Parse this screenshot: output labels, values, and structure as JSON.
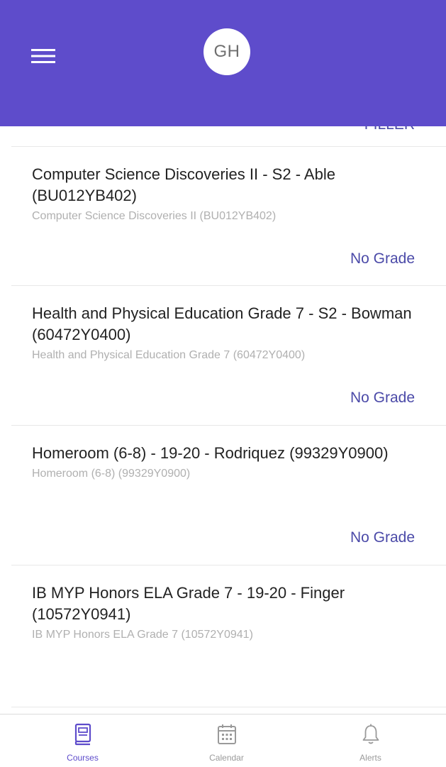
{
  "header": {
    "avatar_initials": "GH",
    "background_color": "#5e4ccb"
  },
  "list": {
    "partial_top_text": "FILLER",
    "courses": [
      {
        "title": "Computer Science Discoveries II - S2 - Able (BU012YB402)",
        "subtitle": "Computer Science Discoveries II (BU012YB402)",
        "grade": "No Grade"
      },
      {
        "title": "Health and Physical Education  Grade 7 - S2 - Bowman (60472Y0400)",
        "subtitle": "Health and Physical Education  Grade 7 (60472Y0400)",
        "grade": "No Grade"
      },
      {
        "title": "Homeroom (6-8) - 19-20 - Rodriquez (99329Y0900)",
        "subtitle": "Homeroom (6-8) (99329Y0900)",
        "grade": "No Grade"
      },
      {
        "title": "IB MYP Honors ELA Grade 7 - 19-20 - Finger (10572Y0941)",
        "subtitle": "IB MYP Honors ELA Grade 7 (10572Y0941)",
        "grade": ""
      }
    ]
  },
  "tabbar": {
    "tabs": [
      {
        "label": "Courses",
        "icon": "book-icon",
        "active": true
      },
      {
        "label": "Calendar",
        "icon": "calendar-icon",
        "active": false
      },
      {
        "label": "Alerts",
        "icon": "bell-icon",
        "active": false
      }
    ]
  },
  "colors": {
    "accent": "#5e4ccb",
    "grade_text": "#4b4aa8",
    "subtitle_text": "#b0b0b0"
  }
}
